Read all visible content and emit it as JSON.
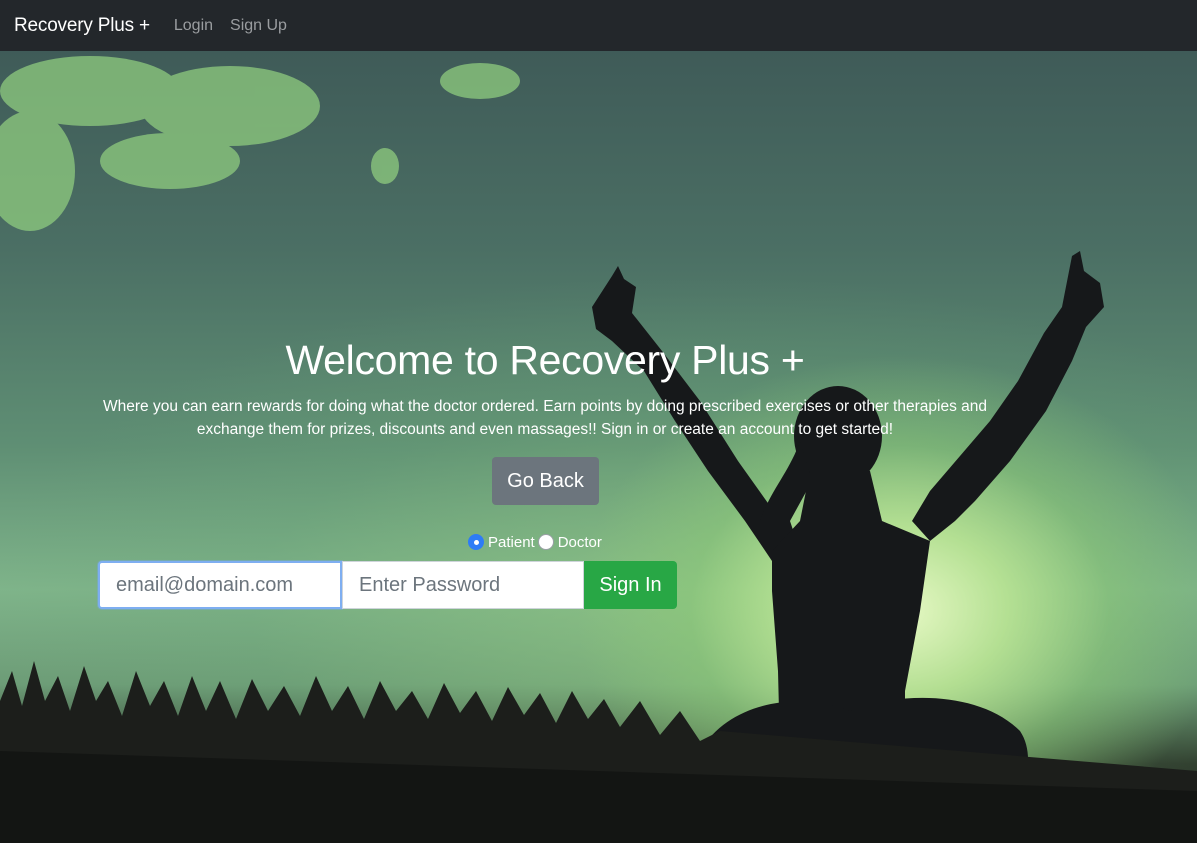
{
  "nav": {
    "brand": "Recovery Plus +",
    "links": [
      "Login",
      "Sign Up"
    ]
  },
  "hero": {
    "title": "Welcome to Recovery Plus +",
    "lead": "Where you can earn rewards for doing what the doctor ordered. Earn points by doing prescribed exercises or other therapies and exchange them for prizes, discounts and even massages!! Sign in or create an account to get started!",
    "back_button": "Go Back"
  },
  "role_options": {
    "options": [
      "Patient",
      "Doctor"
    ],
    "selected": "Patient"
  },
  "signin_form": {
    "email_placeholder": "email@domain.com",
    "password_placeholder": "Enter Password",
    "submit_label": "Sign In"
  },
  "colors": {
    "navbar": "#23272b",
    "back_button": "#6c757d",
    "signin_button": "#28a745",
    "radio_accent": "#2e7cf6"
  }
}
